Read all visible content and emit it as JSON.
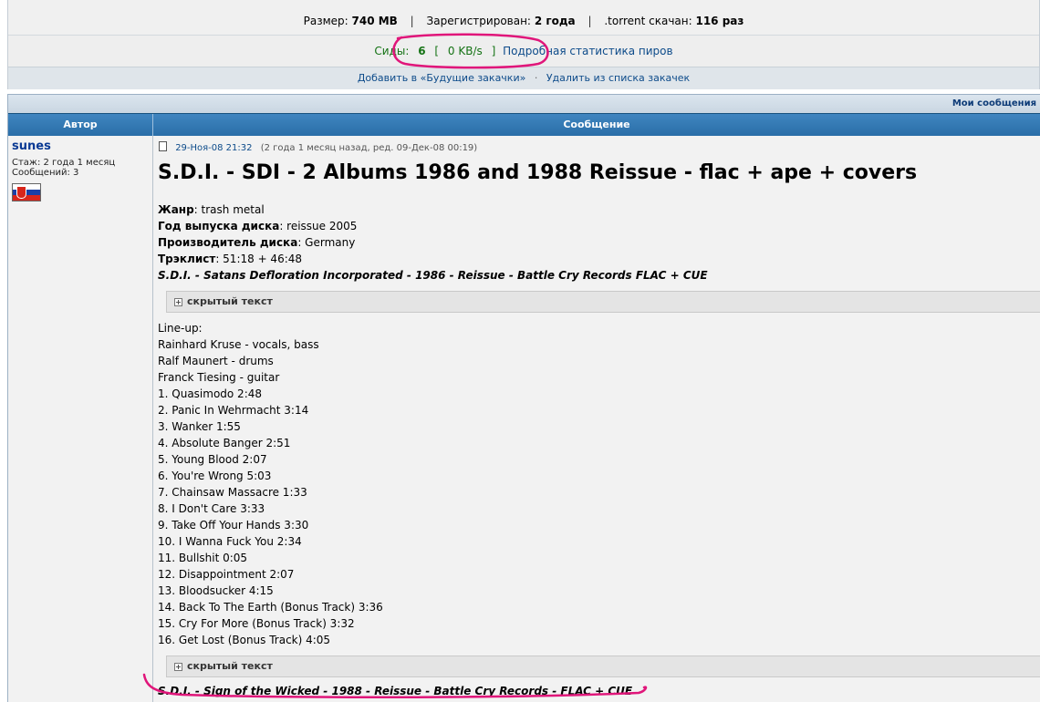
{
  "torrent_info": {
    "size_label": "Размер:",
    "size_value": "740 MB",
    "registered_label": "Зарегистрирован:",
    "registered_value": "2 года",
    "downloaded_label": ".torrent скачан:",
    "downloaded_value": "116 раз",
    "seeds_label": "Сиды:",
    "seeds_value": "6",
    "speed_open": "[",
    "speed_value": "0 KB/s",
    "speed_close": "]",
    "peer_stats_link": "Подробная статистика пиров",
    "add_future_link": "Добавить в «Будущие закачки»",
    "remove_link": "Удалить из списка закачек",
    "separator": "|",
    "dot": "·"
  },
  "my_messages_link": "Мои сообщения",
  "table_header": {
    "author": "Автор",
    "message": "Сообщение"
  },
  "author": {
    "name": "sunes",
    "tenure": "Стаж: 2 года 1 месяц",
    "posts": "Сообщений: 3",
    "flag_icon": "slovakia-flag-icon"
  },
  "post": {
    "date_link": "29-Ноя-08 21:32",
    "date_meta": "(2 года 1 месяц назад, ред. 09-Дек-08 00:19)",
    "title": "S.D.I. - SDI - 2 Albums 1986 and 1988 Reissue - flac + ape + covers",
    "fields": [
      {
        "label": "Жанр",
        "value": ": trash metal"
      },
      {
        "label": "Год выпуска диска",
        "value": ": reissue 2005"
      },
      {
        "label": "Производитель диска",
        "value": ": Germany"
      },
      {
        "label": "Трэклист",
        "value": ": 51:18 + 46:48"
      }
    ],
    "album1": "S.D.I. - Satans Defloration Incorporated - 1986 - Reissue - Battle Cry Records FLAC + CUE",
    "spoiler_label": "скрытый текст",
    "lineup": [
      "Line-up:",
      "Rainhard Kruse - vocals, bass",
      "Ralf Maunert - drums",
      "Franck Tiesing - guitar"
    ],
    "tracks": [
      "1. Quasimodo 2:48",
      "2. Panic In Wehrmacht 3:14",
      "3. Wanker 1:55",
      "4. Absolute Banger 2:51",
      "5. Young Blood 2:07",
      "6. You're Wrong 5:03",
      "7. Chainsaw Massacre 1:33",
      "8. I Don't Care 3:33",
      "9. Take Off Your Hands 3:30",
      "10. I Wanna Fuck You 2:34",
      "11. Bullshit 0:05",
      "12. Disappointment 2:07",
      "13. Bloodsucker 4:15",
      "14. Back To The Earth (Bonus Track) 3:36",
      "15. Cry For More (Bonus Track) 3:32",
      "16. Get Lost (Bonus Track) 4:05"
    ],
    "album2": "S.D.I. - Sign of the Wicked - 1988 - Reissue - Battle Cry Records - FLAC + CUE"
  },
  "colors": {
    "header_blue": "#2a6ea8",
    "link_blue": "#0d4b8a",
    "seed_green": "#147214",
    "annotation_pink": "#e0167a"
  }
}
